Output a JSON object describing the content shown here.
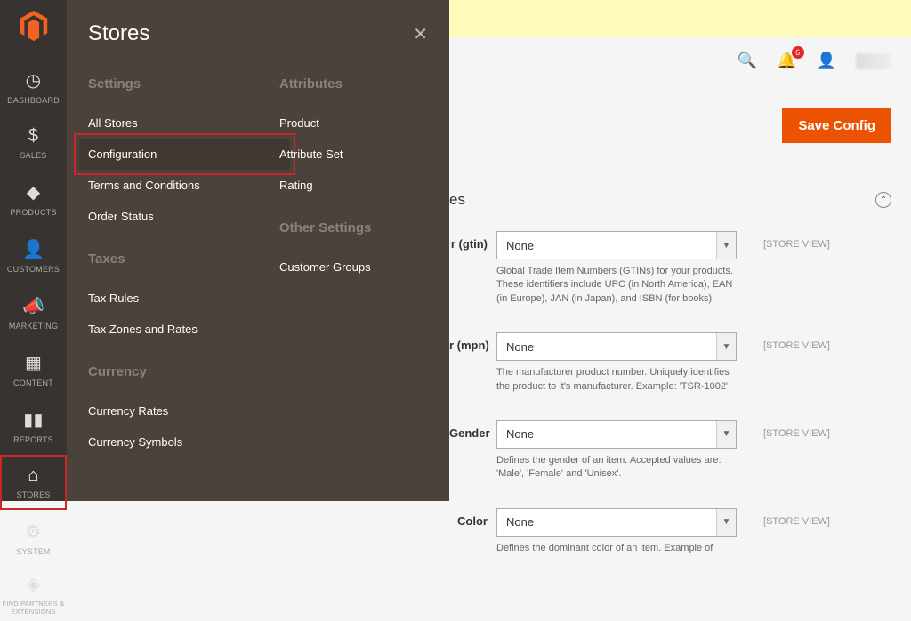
{
  "nav": {
    "items": [
      {
        "label": "DASHBOARD",
        "icon": "◷"
      },
      {
        "label": "SALES",
        "icon": "$"
      },
      {
        "label": "PRODUCTS",
        "icon": "◆"
      },
      {
        "label": "CUSTOMERS",
        "icon": "👤"
      },
      {
        "label": "MARKETING",
        "icon": "📣"
      },
      {
        "label": "CONTENT",
        "icon": "▦"
      },
      {
        "label": "REPORTS",
        "icon": "▮▮"
      },
      {
        "label": "STORES",
        "icon": "⌂"
      },
      {
        "label": "SYSTEM",
        "icon": "⚙"
      },
      {
        "label": "FIND PARTNERS & EXTENSIONS",
        "icon": "◈"
      }
    ]
  },
  "flyout": {
    "title": "Stores",
    "col1": {
      "settings_head": "Settings",
      "settings": [
        "All Stores",
        "Configuration",
        "Terms and Conditions",
        "Order Status"
      ],
      "taxes_head": "Taxes",
      "taxes": [
        "Tax Rules",
        "Tax Zones and Rates"
      ],
      "currency_head": "Currency",
      "currency": [
        "Currency Rates",
        "Currency Symbols"
      ]
    },
    "col2": {
      "attr_head": "Attributes",
      "attr": [
        "Product",
        "Attribute Set",
        "Rating"
      ],
      "other_head": "Other Settings",
      "other": [
        "Customer Groups"
      ]
    }
  },
  "top": {
    "badge_count": "6",
    "save_label": "Save Config"
  },
  "section_title_suffix": "es",
  "scope_label": "[STORE VIEW]",
  "select_value": "None",
  "rows": [
    {
      "label": "r (gtin)",
      "hint": "Global Trade Item Numbers (GTINs) for your products. These identifiers include UPC (in North America), EAN (in Europe), JAN (in Japan), and ISBN (for books)."
    },
    {
      "label": "r (mpn)",
      "hint": "The manufacturer product number. Uniquely identifies the product to it's manufacturer. Example: 'TSR-1002'"
    },
    {
      "label": "Gender",
      "hint": "Defines the gender of an item. Accepted values are: 'Male', 'Female' and 'Unisex'."
    },
    {
      "label": "Color",
      "hint": "Defines the dominant color of an item. Example of"
    }
  ]
}
